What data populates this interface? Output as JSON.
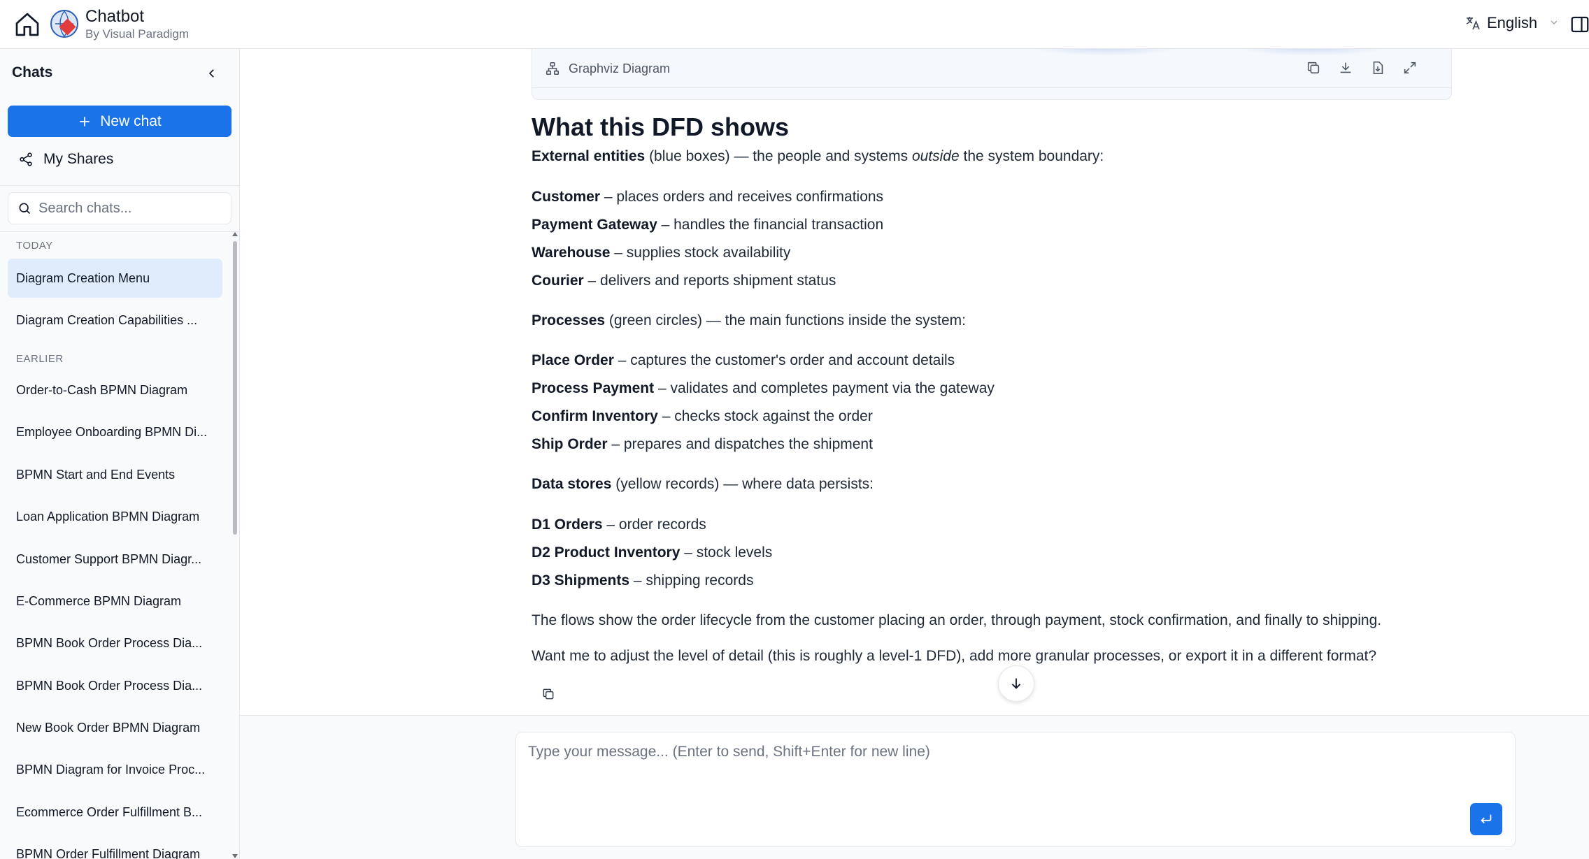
{
  "app": {
    "title": "Chatbot",
    "subtitle": "By Visual Paradigm",
    "language": "English"
  },
  "sidebar": {
    "heading": "Chats",
    "new_chat_label": "New chat",
    "my_shares_label": "My Shares",
    "search_placeholder": "Search chats...",
    "sections": [
      {
        "label": "TODAY",
        "items": [
          {
            "label": "Diagram Creation Menu",
            "active": true
          },
          {
            "label": "Diagram Creation Capabilities ...",
            "active": false
          }
        ]
      },
      {
        "label": "EARLIER",
        "items": [
          {
            "label": "Order-to-Cash BPMN Diagram"
          },
          {
            "label": "Employee Onboarding BPMN Di..."
          },
          {
            "label": "BPMN Start and End Events"
          },
          {
            "label": "Loan Application BPMN Diagram"
          },
          {
            "label": "Customer Support BPMN Diagr..."
          },
          {
            "label": "E-Commerce BPMN Diagram"
          },
          {
            "label": "BPMN Book Order Process Dia..."
          },
          {
            "label": "BPMN Book Order Process Dia..."
          },
          {
            "label": "New Book Order BPMN Diagram"
          },
          {
            "label": "BPMN Diagram for Invoice Proc..."
          },
          {
            "label": "Ecommerce Order Fulfillment B..."
          },
          {
            "label": "BPMN Order Fulfillment Diagram"
          }
        ]
      }
    ]
  },
  "diagram_card": {
    "title": "Graphviz Diagram"
  },
  "message": {
    "heading": "What this DFD shows",
    "entities_intro": {
      "bold": "External entities",
      "rest_before_italic": " (blue boxes) — the people and systems ",
      "italic": "outside",
      "rest_after_italic": " the system boundary:"
    },
    "entities": [
      {
        "name": "Customer",
        "desc": " – places orders and receives confirmations"
      },
      {
        "name": "Payment Gateway",
        "desc": " – handles the financial transaction"
      },
      {
        "name": "Warehouse",
        "desc": " – supplies stock availability"
      },
      {
        "name": "Courier",
        "desc": " – delivers and reports shipment status"
      }
    ],
    "processes_intro": {
      "bold": "Processes",
      "rest": " (green circles) — the main functions inside the system:"
    },
    "processes": [
      {
        "name": "Place Order",
        "desc": " – captures the customer's order and account details"
      },
      {
        "name": "Process Payment",
        "desc": " – validates and completes payment via the gateway"
      },
      {
        "name": "Confirm Inventory",
        "desc": " – checks stock against the order"
      },
      {
        "name": "Ship Order",
        "desc": " – prepares and dispatches the shipment"
      }
    ],
    "stores_intro": {
      "bold": "Data stores",
      "rest": " (yellow records) — where data persists:"
    },
    "stores": [
      {
        "name": "D1 Orders",
        "desc": " – order records"
      },
      {
        "name": "D2 Product Inventory",
        "desc": " – stock levels"
      },
      {
        "name": "D3 Shipments",
        "desc": " – shipping records"
      }
    ],
    "flows_text": "The flows show the order lifecycle from the customer placing an order, through payment, stock confirmation, and finally to shipping.",
    "followup_text": "Want me to adjust the level of detail (this is roughly a level-1 DFD), add more granular processes, or export it in a different format?"
  },
  "composer": {
    "placeholder": "Type your message... (Enter to send, Shift+Enter for new line)"
  },
  "colors": {
    "accent": "#1a73e8",
    "active_item_bg": "#e0ecfb",
    "sidebar_bg": "#f9fafb"
  },
  "icons": [
    "home-icon",
    "chatbot-logo",
    "translate-icon",
    "chevron-down-icon",
    "panel-toggle-icon",
    "chevron-left-icon",
    "plus-icon",
    "share-icon",
    "search-icon",
    "diagram-icon",
    "copy-icon",
    "download-icon",
    "export-file-icon",
    "expand-icon",
    "arrow-down-icon",
    "send-icon"
  ]
}
